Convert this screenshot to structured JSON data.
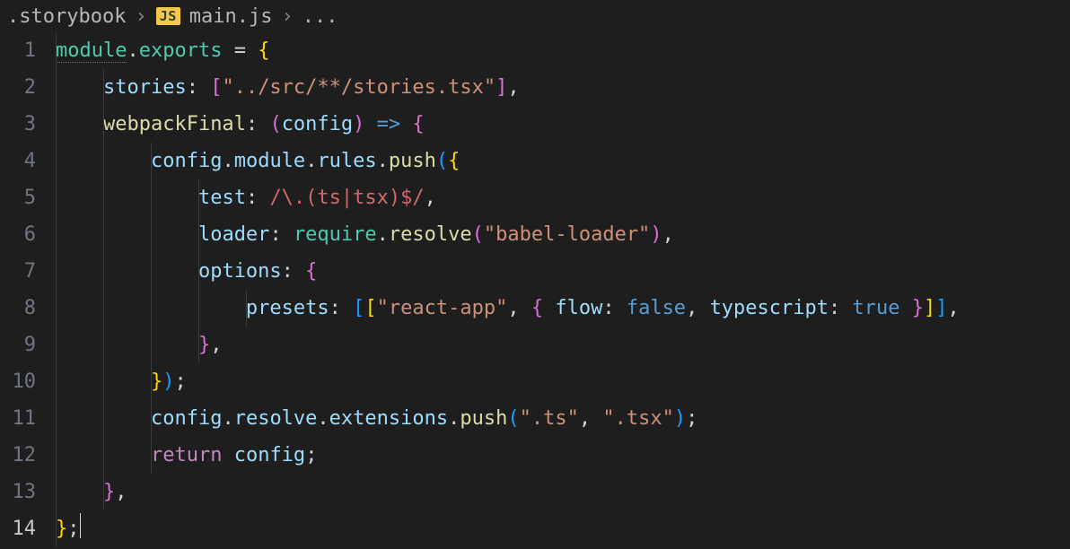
{
  "breadcrumb": {
    "folder": ".storybook",
    "js_badge": "JS",
    "file": "main.js",
    "tail": "..."
  },
  "code": {
    "l1": {
      "module": "module",
      "dot1": ".",
      "exports": "exports",
      "eq": " = ",
      "ob": "{"
    },
    "l2": {
      "indent": "    ",
      "stories": "stories",
      "colon": ":",
      "sp": " ",
      "lb": "[",
      "str": "\"../src/**/stories.tsx\"",
      "rb": "]",
      "comma": ","
    },
    "l3": {
      "indent": "    ",
      "webpackFinal": "webpackFinal",
      "colon": ":",
      "sp": " ",
      "lp": "(",
      "config": "config",
      "rp": ")",
      "arrow": " => ",
      "ob": "{"
    },
    "l4": {
      "indent": "        ",
      "config": "config",
      "d1": ".",
      "module": "module",
      "d2": ".",
      "rules": "rules",
      "d3": ".",
      "push": "push",
      "lp": "(",
      "ob": "{"
    },
    "l5": {
      "indent": "            ",
      "test": "test",
      "colon": ":",
      "sp": " ",
      "regex": "/\\.(ts|tsx)$/",
      "comma": ","
    },
    "l6": {
      "indent": "            ",
      "loader": "loader",
      "colon": ":",
      "sp": " ",
      "require": "require",
      "dot": ".",
      "resolve": "resolve",
      "lp": "(",
      "str": "\"babel-loader\"",
      "rp": ")",
      "comma": ","
    },
    "l7": {
      "indent": "            ",
      "options": "options",
      "colon": ":",
      "sp": " ",
      "ob": "{"
    },
    "l8": {
      "indent": "                ",
      "presets": "presets",
      "colon": ":",
      "sp": " ",
      "lb1": "[",
      "lb2": "[",
      "str": "\"react-app\"",
      "c1": ",",
      "sp2": " ",
      "ob": "{",
      "sp3": " ",
      "flow": "flow",
      "c2": ":",
      "sp4": " ",
      "false": "false",
      "c3": ",",
      "sp5": " ",
      "ts": "typescript",
      "c4": ":",
      "sp6": " ",
      "true": "true",
      "sp7": " ",
      "cb": "}",
      "rb2": "]",
      "rb1": "]",
      "comma": ","
    },
    "l9": {
      "indent": "            ",
      "cb": "}",
      "comma": ","
    },
    "l10": {
      "indent": "        ",
      "cb": "}",
      "rp": ")",
      "semi": ";"
    },
    "l11": {
      "indent": "        ",
      "config": "config",
      "d1": ".",
      "resolve": "resolve",
      "d2": ".",
      "extensions": "extensions",
      "d3": ".",
      "push": "push",
      "lp": "(",
      "s1": "\".ts\"",
      "c": ",",
      "sp": " ",
      "s2": "\".tsx\"",
      "rp": ")",
      "semi": ";"
    },
    "l12": {
      "indent": "        ",
      "return": "return",
      "sp": " ",
      "config": "config",
      "semi": ";"
    },
    "l13": {
      "indent": "    ",
      "cb": "}",
      "comma": ","
    },
    "l14": {
      "cb": "}",
      "semi": ";"
    }
  },
  "line_numbers": [
    "1",
    "2",
    "3",
    "4",
    "5",
    "6",
    "7",
    "8",
    "9",
    "10",
    "11",
    "12",
    "13",
    "14"
  ]
}
